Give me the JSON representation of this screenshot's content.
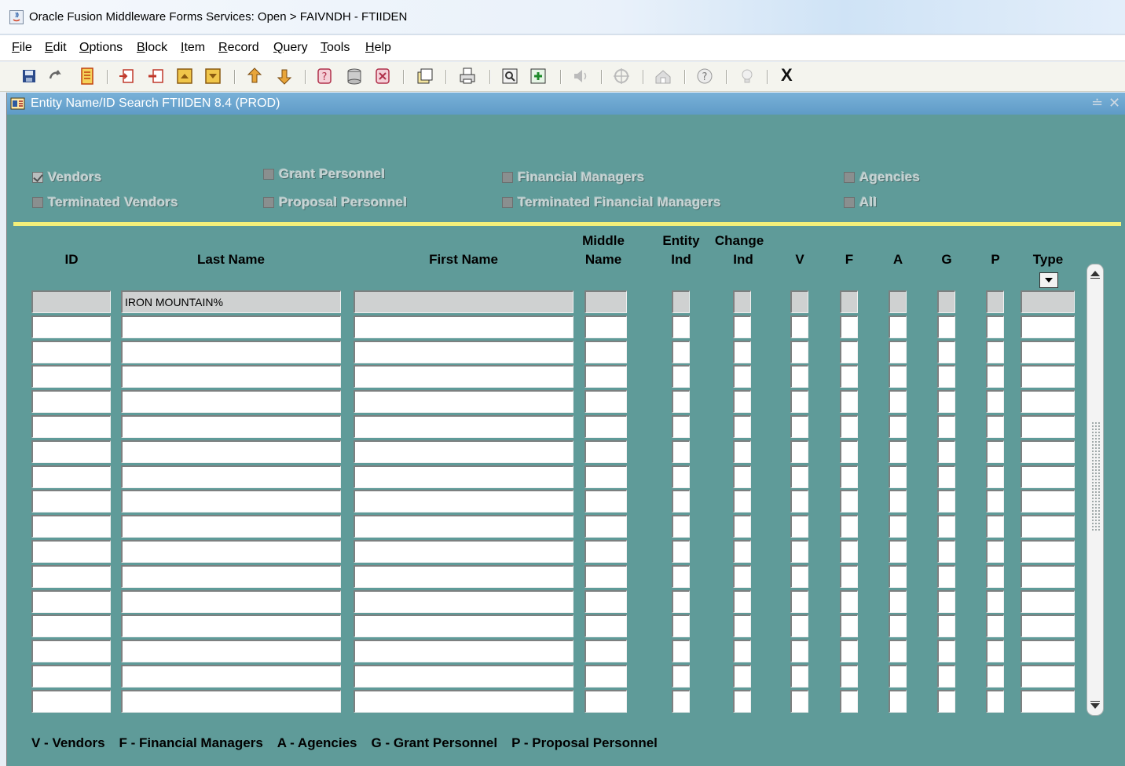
{
  "window": {
    "title": "Oracle Fusion Middleware Forms Services:  Open > FAIVNDH - FTIIDEN"
  },
  "menu": {
    "items": [
      {
        "key": "F",
        "rest": "ile"
      },
      {
        "key": "E",
        "rest": "dit"
      },
      {
        "key": "O",
        "rest": "ptions"
      },
      {
        "key": "B",
        "rest": "lock"
      },
      {
        "key": "I",
        "rest": "tem"
      },
      {
        "key": "R",
        "rest": "ecord"
      },
      {
        "key": "Q",
        "rest": "uery"
      },
      {
        "key": "T",
        "rest": "ools"
      },
      {
        "key": "H",
        "rest": "elp"
      }
    ]
  },
  "toolbar": {
    "exit_label": "X",
    "icons": [
      "save-icon",
      "rollback-icon",
      "open-form-icon",
      "insert-record-icon",
      "remove-record-icon",
      "previous-block-icon",
      "next-block-icon",
      "enter-query-icon",
      "execute-query-icon",
      "cancel-query-icon",
      "count-query-icon",
      "clear-icon",
      "copy-icon",
      "print-icon",
      "search-icon",
      "add-icon",
      "sound-icon",
      "options-icon",
      "tools-icon",
      "help-icon",
      "hint-icon"
    ]
  },
  "form": {
    "title": "Entity Name/ID Search  FTIIDEN  8.4  (PROD)",
    "checkboxes": [
      {
        "label": "Vendors",
        "checked": true
      },
      {
        "label": "Grant Personnel",
        "checked": false
      },
      {
        "label": "Financial Managers",
        "checked": false
      },
      {
        "label": "Agencies",
        "checked": false
      },
      {
        "label": "Terminated Vendors",
        "checked": false
      },
      {
        "label": "Proposal Personnel",
        "checked": false
      },
      {
        "label": "Terminated Financial Managers",
        "checked": false
      },
      {
        "label": "All",
        "checked": false
      }
    ],
    "columns": {
      "id": "ID",
      "last_name": "Last Name",
      "first_name": "First Name",
      "middle_name_1": "Middle",
      "middle_name_2": "Name",
      "entity_ind_1": "Entity",
      "entity_ind_2": "Ind",
      "change_ind_1": "Change",
      "change_ind_2": "Ind",
      "v": "V",
      "f": "F",
      "a": "A",
      "g": "G",
      "p": "P",
      "type": "Type"
    },
    "rows": [
      {
        "last_name": "IRON MOUNTAIN%"
      },
      {},
      {},
      {},
      {},
      {},
      {},
      {},
      {},
      {},
      {},
      {},
      {},
      {},
      {},
      {},
      {}
    ],
    "legend": [
      "V - Vendors",
      "F - Financial Managers",
      "A - Agencies",
      "G - Grant Personnel",
      "P - Proposal Personnel"
    ]
  },
  "colors": {
    "form_bg": "#5f9b99",
    "header_blue": "#6aa5cf",
    "separator_yellow": "#f4f07a",
    "current_row": "#cfd1d1"
  }
}
